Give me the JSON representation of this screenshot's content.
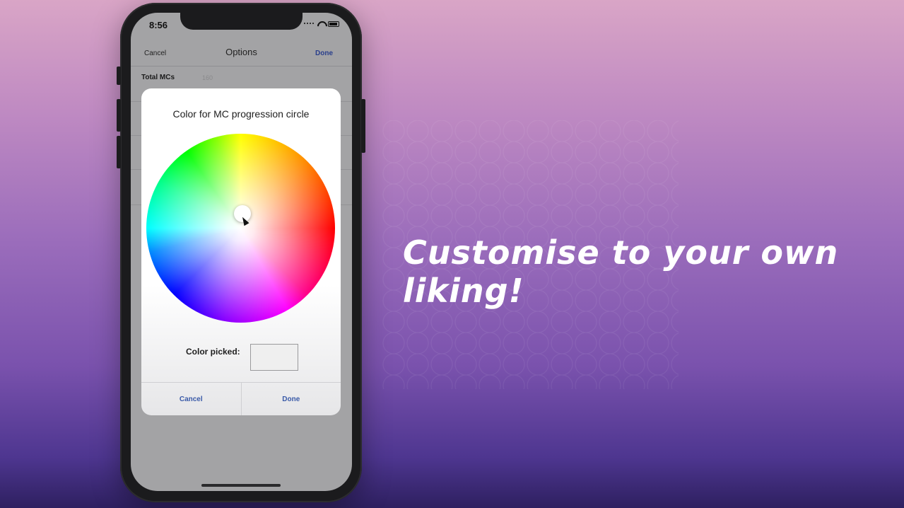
{
  "status_bar": {
    "time": "8:56"
  },
  "nav": {
    "cancel": "Cancel",
    "title": "Options",
    "done": "Done"
  },
  "settings_rows": [
    {
      "label": "Total MCs",
      "value": "160"
    }
  ],
  "dialog": {
    "title": "Color for MC progression circle",
    "picked_label": "Color picked:",
    "picked_color": "#efefef",
    "cancel": "Cancel",
    "done": "Done"
  },
  "headline": "Customise to your own liking!",
  "icons": [
    "signal-icon",
    "wifi-icon",
    "battery-icon",
    "color-wheel-icon",
    "cursor-icon"
  ]
}
